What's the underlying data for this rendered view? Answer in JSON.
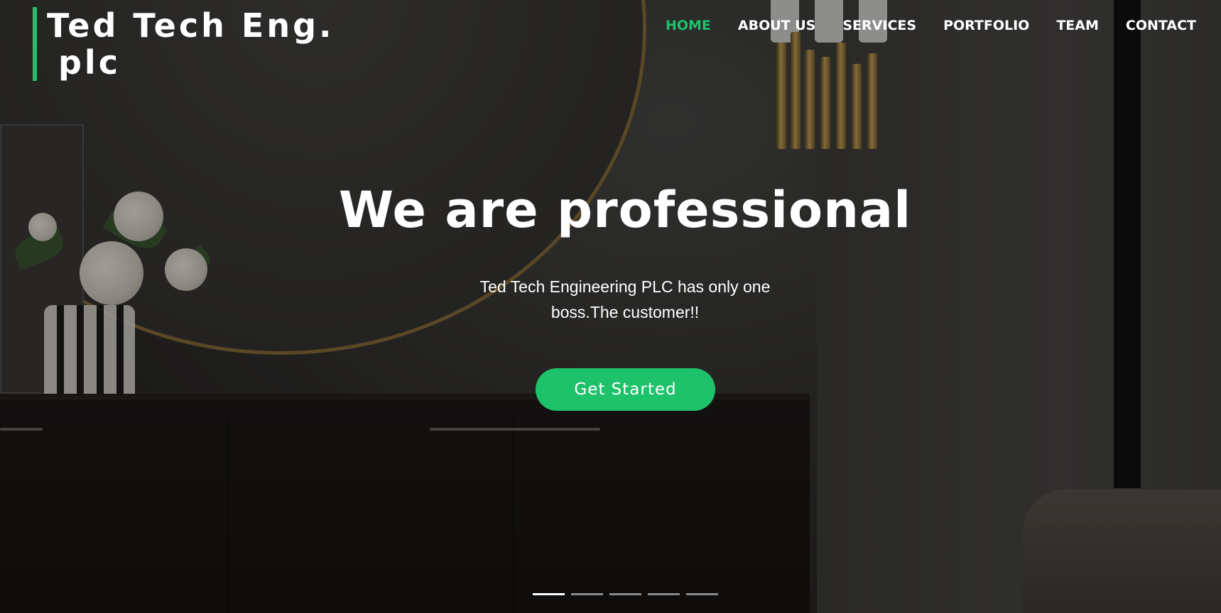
{
  "brand": {
    "line1": "Ted Tech Eng.",
    "line2": "plc",
    "accent_color": "#1ec26a"
  },
  "nav": {
    "items": [
      {
        "label": "HOME",
        "active": true
      },
      {
        "label": "ABOUT US",
        "active": false
      },
      {
        "label": "SERVICES",
        "active": false
      },
      {
        "label": "PORTFOLIO",
        "active": false
      },
      {
        "label": "TEAM",
        "active": false
      },
      {
        "label": "CONTACT",
        "active": false
      }
    ]
  },
  "hero": {
    "title": "We are professional",
    "subtitle_line1": "Ted Tech Engineering PLC has only one",
    "subtitle_line2": "boss.The customer!!",
    "cta_label": "Get Started",
    "cta_color": "#1ec26a"
  },
  "carousel": {
    "slide_count": 5,
    "active_index": 0
  }
}
